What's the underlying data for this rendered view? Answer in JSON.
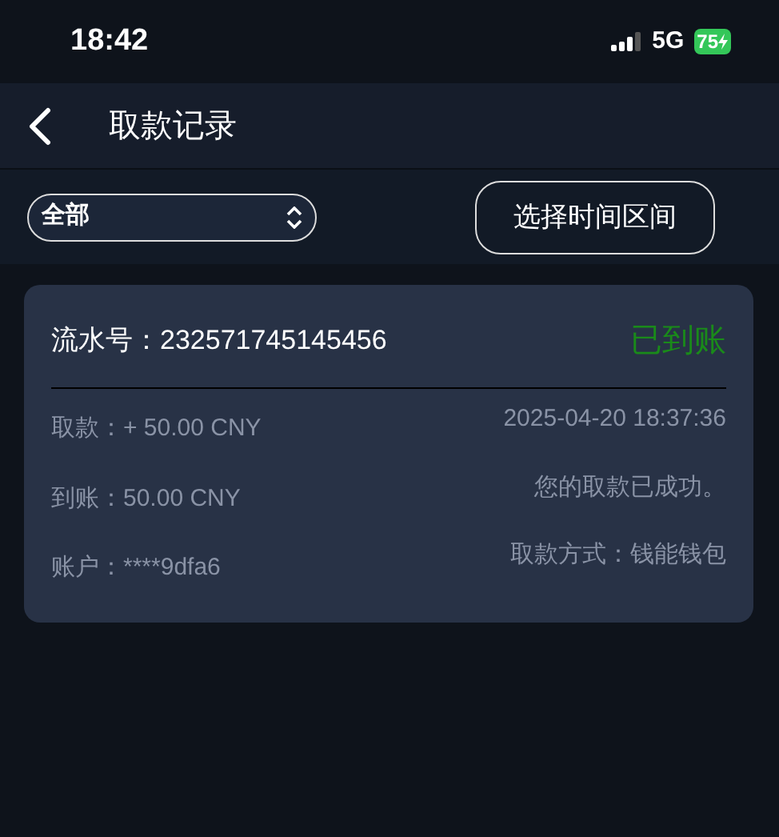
{
  "status_bar": {
    "time": "18:42",
    "network": "5G",
    "battery": "75"
  },
  "header": {
    "title": "取款记录"
  },
  "filter": {
    "select_value": "全部",
    "date_button": "选择时间区间"
  },
  "records": [
    {
      "serial_label": "流水号：",
      "serial": "232571745145456",
      "status": {
        "text": "已到账",
        "kind": "arrived"
      },
      "left": [
        {
          "label": "取款：",
          "value": "+ 50.00 CNY"
        },
        {
          "label": "到账：",
          "value": "50.00 CNY"
        },
        {
          "label": "账户：",
          "value": "****9dfa6"
        }
      ],
      "right": [
        "2025-04-20 18:37:36",
        "您的取款已成功。",
        "取款方式：钱能钱包"
      ]
    }
  ]
}
